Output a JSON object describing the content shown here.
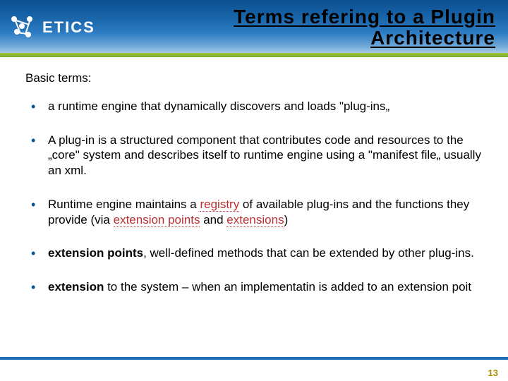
{
  "header": {
    "brand": "ETICS",
    "title_line1": "Terms refering to a  Plugin",
    "title_line2": "Architecture"
  },
  "content": {
    "basic_terms_label": "Basic terms:",
    "bullets": {
      "b1": "a runtime engine that dynamically discovers and loads \"plug-ins„",
      "b2": "A plug-in is a structured component that contributes code and resources to the „core\" system and describes itself to runtime engine using a \"manifest file„ usually an xml.",
      "b3_pre": "Runtime engine maintains a ",
      "b3_reg": "registry",
      "b3_mid1": " of available plug-ins and the functions they provide (via ",
      "b3_ep": "extension points",
      "b3_mid2": " and ",
      "b3_ext": "extensions",
      "b3_end": ")",
      "b4_term": "extension points",
      "b4_rest": ", well-defined methods that can be extended by other plug-ins.",
      "b5_term": "extension",
      "b5_rest": " to the system – when an implementatin is added to an extension poit"
    }
  },
  "footer": {
    "page_number": "13"
  }
}
